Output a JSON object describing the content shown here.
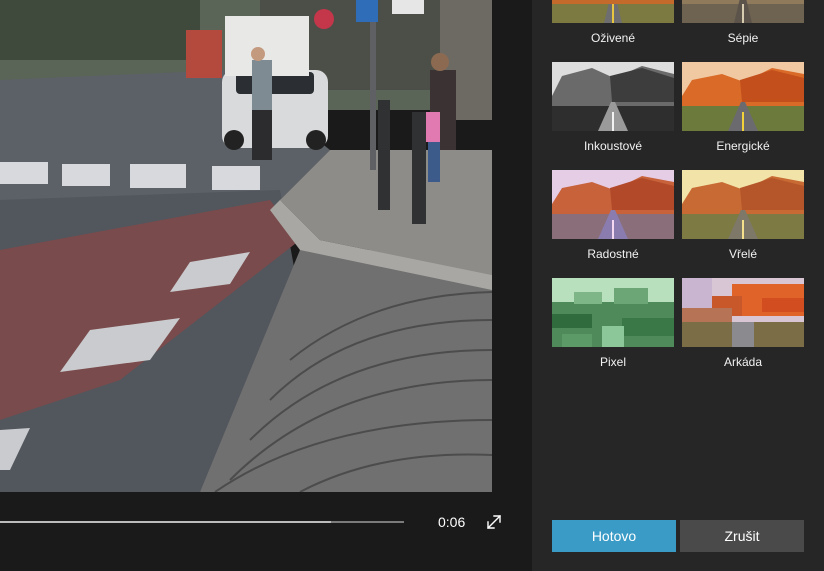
{
  "player": {
    "time": "0:06",
    "progress_fraction": 0.82,
    "expand_icon": "expand-icon"
  },
  "filters": [
    {
      "label": "Oživené",
      "tone": "vivid"
    },
    {
      "label": "Sépie",
      "tone": "sepia"
    },
    {
      "label": "Inkoustové",
      "tone": "ink"
    },
    {
      "label": "Energické",
      "tone": "energy"
    },
    {
      "label": "Radostné",
      "tone": "joy"
    },
    {
      "label": "Vřelé",
      "tone": "warm"
    },
    {
      "label": "Pixel",
      "tone": "pixel"
    },
    {
      "label": "Arkáda",
      "tone": "arcade"
    }
  ],
  "actions": {
    "done_label": "Hotovo",
    "cancel_label": "Zrušit"
  },
  "colors": {
    "accent": "#3a9bc6",
    "panel_bg": "#272626",
    "cancel_bg": "#4b4a4a"
  }
}
